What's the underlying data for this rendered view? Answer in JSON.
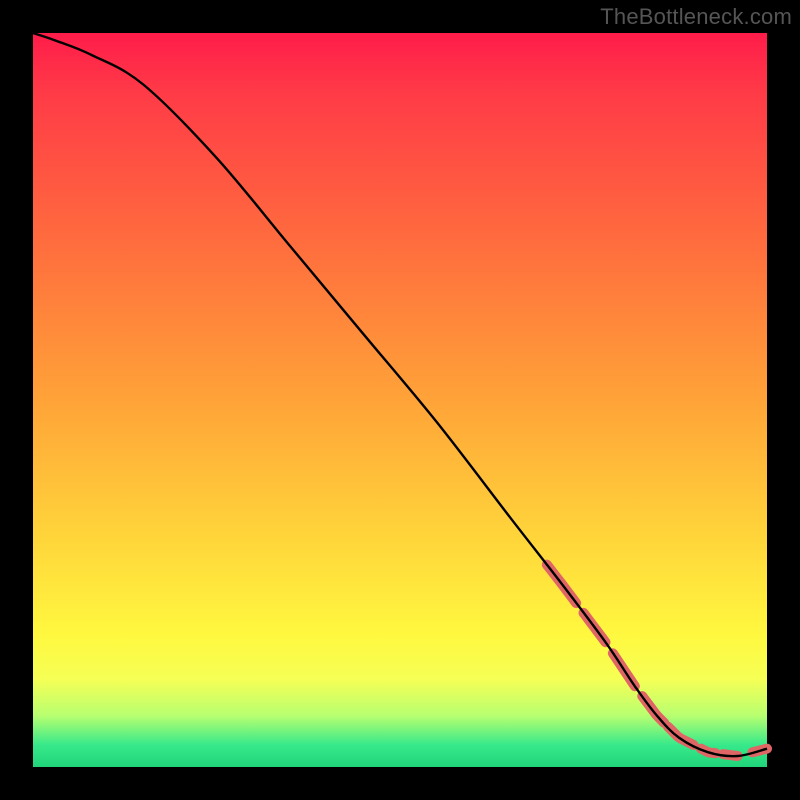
{
  "brand": "TheBottleneck.com",
  "chart_data": {
    "type": "line",
    "title": "",
    "xlabel": "",
    "ylabel": "",
    "xlim": [
      0,
      100
    ],
    "ylim": [
      0,
      100
    ],
    "grid": false,
    "legend": false,
    "series": [
      {
        "name": "curve",
        "x": [
          0,
          3,
          8,
          15,
          25,
          35,
          45,
          55,
          65,
          72,
          78,
          82,
          85,
          88,
          92,
          96,
          100
        ],
        "y": [
          100,
          99,
          97,
          93,
          83,
          71,
          59,
          47,
          34,
          25,
          17,
          11,
          7,
          4,
          2,
          1.5,
          2.5
        ]
      }
    ],
    "highlight_segments": [
      {
        "start_x": 70,
        "end_x": 74
      },
      {
        "start_x": 75,
        "end_x": 78
      },
      {
        "start_x": 79,
        "end_x": 82
      },
      {
        "start_x": 83,
        "end_x": 86
      },
      {
        "start_x": 86.5,
        "end_x": 90
      },
      {
        "start_x": 91,
        "end_x": 93
      },
      {
        "start_x": 94,
        "end_x": 96
      },
      {
        "start_x": 98,
        "end_x": 100
      }
    ],
    "highlight_style": {
      "color": "#e06666",
      "width": 10,
      "cap": "round"
    },
    "background_gradient": {
      "stops": [
        {
          "pos": 0.0,
          "color": "#ff1c4a"
        },
        {
          "pos": 0.28,
          "color": "#ff6b3e"
        },
        {
          "pos": 0.5,
          "color": "#ffa338"
        },
        {
          "pos": 0.82,
          "color": "#fff83f"
        },
        {
          "pos": 0.97,
          "color": "#37e98a"
        }
      ]
    }
  }
}
